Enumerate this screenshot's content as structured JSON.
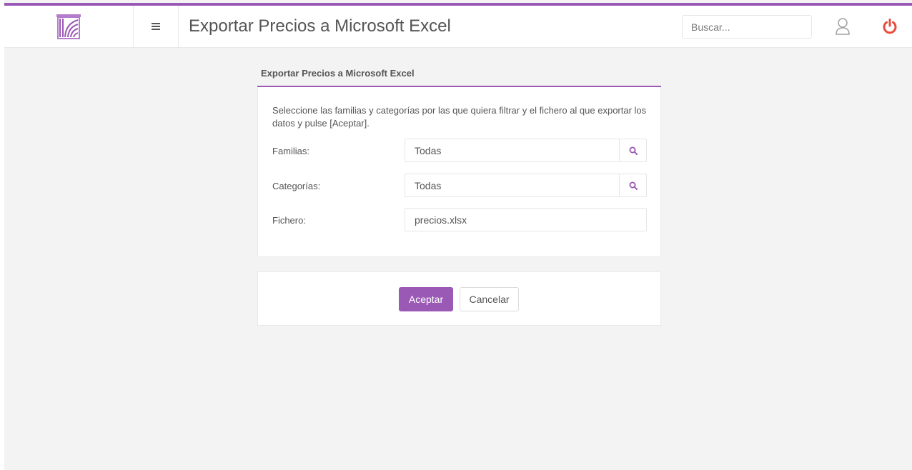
{
  "header": {
    "title": "Exportar Precios a Microsoft Excel",
    "search_placeholder": "Buscar...",
    "accent_color": "#9b59b6",
    "power_color": "#e74c3c"
  },
  "panel": {
    "title": "Exportar Precios a Microsoft Excel",
    "instructions": "Seleccione las familias y categorías por las que quiera filtrar y el fichero al que exportar los datos y pulse [Aceptar].",
    "fields": [
      {
        "label": "Familias:",
        "value": "Todas",
        "has_search": true
      },
      {
        "label": "Categorías:",
        "value": "Todas",
        "has_search": true
      },
      {
        "label": "Fichero:",
        "value": "precios.xlsx",
        "has_search": false
      }
    ]
  },
  "actions": {
    "accept_label": "Aceptar",
    "cancel_label": "Cancelar"
  },
  "icons": {
    "logo": "logo-icon",
    "menu": "menu-icon",
    "user": "user-icon",
    "power": "power-icon",
    "search": "search-icon"
  }
}
